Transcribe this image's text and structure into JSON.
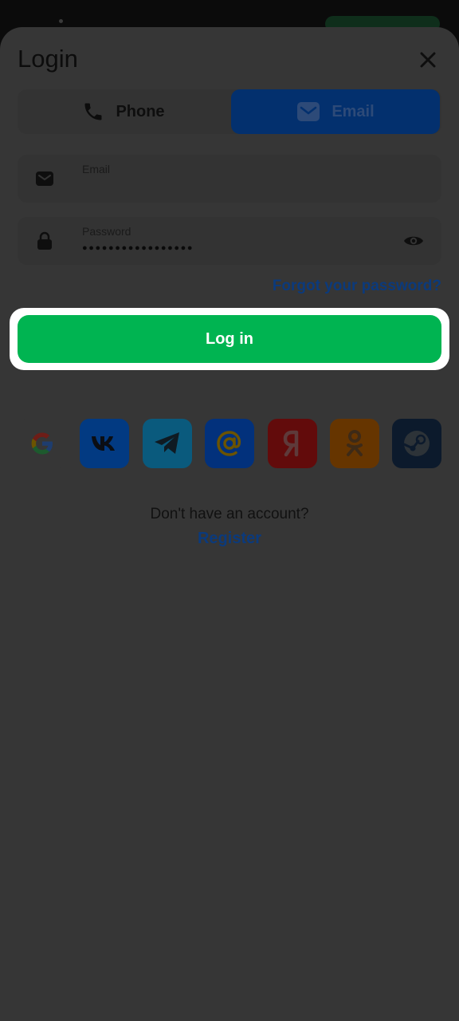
{
  "login_sheet": {
    "title": "Login",
    "tabs": [
      {
        "label": "Phone",
        "icon": "phone-icon",
        "active": false
      },
      {
        "label": "Email",
        "icon": "mail-icon",
        "active": true
      }
    ],
    "email_field": {
      "label": "Email",
      "value": "",
      "icon": "mail-icon"
    },
    "password_field": {
      "label": "Password",
      "value": "●●●●●●●●●●●●●●●●●",
      "icon": "lock-icon"
    },
    "forgot_link": "Forgot your password?",
    "login_button": "Log in",
    "social_logins": [
      {
        "name": "Google",
        "icon": "google-icon",
        "color": "#363636"
      },
      {
        "name": "VK",
        "icon": "vk-icon",
        "color": "#023a82"
      },
      {
        "name": "Telegram",
        "icon": "telegram-icon",
        "color": "#0a5a7d"
      },
      {
        "name": "Mail.ru",
        "icon": "mailru-at-icon",
        "color": "#02317c"
      },
      {
        "name": "Yandex",
        "icon": "yandex-icon",
        "color": "#620b0b"
      },
      {
        "name": "Odnoklassniki",
        "icon": "odnoklassniki-icon",
        "color": "#663500"
      },
      {
        "name": "Steam",
        "icon": "steam-icon",
        "color": "#0c1a2c"
      }
    ],
    "no_account_text": "Don't have an account?",
    "register_link": "Register"
  },
  "colors": {
    "overlay": "#363636",
    "accent_green": "#00b451",
    "active_tab": "#03306e",
    "link": "#0b3a7c"
  }
}
